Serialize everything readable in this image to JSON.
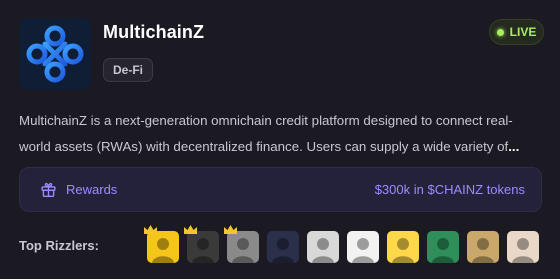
{
  "project": {
    "name": "MultichainZ",
    "category": "De-Fi",
    "status": "LIVE",
    "logo_icon": "chain-knot-icon",
    "description": "MultichainZ is a next-generation omnichain credit platform designed to connect real-world assets (RWAs) with decentralized finance. Users can supply a wide variety of",
    "description_ellipsis": "..."
  },
  "rewards": {
    "icon": "gift-icon",
    "label": "Rewards",
    "value": "$300k in $CHAINZ tokens"
  },
  "top_rizzlers": {
    "label": "Top Rizzlers:",
    "avatars": [
      {
        "name": "avatar-1",
        "crowned": true,
        "bg": "#f5c518"
      },
      {
        "name": "avatar-2",
        "crowned": true,
        "bg": "#3a3a3a"
      },
      {
        "name": "avatar-3",
        "crowned": true,
        "bg": "#8a8a8a"
      },
      {
        "name": "avatar-4",
        "crowned": false,
        "bg": "#2a2f4a"
      },
      {
        "name": "avatar-5",
        "crowned": false,
        "bg": "#d8d8d8"
      },
      {
        "name": "avatar-6",
        "crowned": false,
        "bg": "#f2f2f2"
      },
      {
        "name": "avatar-7",
        "crowned": false,
        "bg": "#ffd84a"
      },
      {
        "name": "avatar-8",
        "crowned": false,
        "bg": "#2e8f5a"
      },
      {
        "name": "avatar-9",
        "crowned": false,
        "bg": "#c9a86a"
      },
      {
        "name": "avatar-10",
        "crowned": false,
        "bg": "#e9d7c7"
      }
    ]
  },
  "colors": {
    "accent": "#9b8cff",
    "live": "#a6f05a",
    "crown": "#f4c430"
  }
}
